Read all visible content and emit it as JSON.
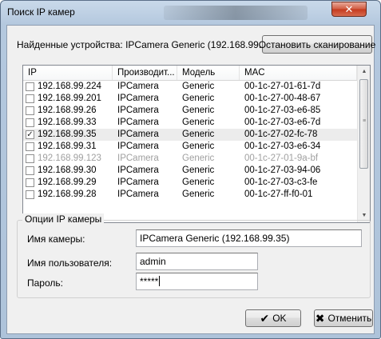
{
  "window": {
    "title": "Поиск IP камер",
    "close_glyph": "✕"
  },
  "found": {
    "label": "Найденные устройства: IPCamera Generic (192.168.99.38)",
    "stop_button": "Остановить сканирование"
  },
  "table": {
    "columns": [
      "IP",
      "Производит...",
      "Модель",
      "MAC"
    ],
    "rows": [
      {
        "checked": false,
        "disabled": false,
        "ip": "192.168.99.224",
        "maker": "IPCamera",
        "model": "Generic",
        "mac": "00-1c-27-01-61-7d"
      },
      {
        "checked": false,
        "disabled": false,
        "ip": "192.168.99.201",
        "maker": "IPCamera",
        "model": "Generic",
        "mac": "00-1c-27-00-48-67"
      },
      {
        "checked": false,
        "disabled": false,
        "ip": "192.168.99.26",
        "maker": "IPCamera",
        "model": "Generic",
        "mac": "00-1c-27-03-e6-85"
      },
      {
        "checked": false,
        "disabled": false,
        "ip": "192.168.99.33",
        "maker": "IPCamera",
        "model": "Generic",
        "mac": "00-1c-27-03-e6-7d"
      },
      {
        "checked": true,
        "disabled": false,
        "selected": true,
        "ip": "192.168.99.35",
        "maker": "IPCamera",
        "model": "Generic",
        "mac": "00-1c-27-02-fc-78"
      },
      {
        "checked": false,
        "disabled": false,
        "ip": "192.168.99.31",
        "maker": "IPCamera",
        "model": "Generic",
        "mac": "00-1c-27-03-e6-34"
      },
      {
        "checked": false,
        "disabled": true,
        "ip": "192.168.99.123",
        "maker": "IPCamera",
        "model": "Generic",
        "mac": "00-1c-27-01-9a-bf"
      },
      {
        "checked": false,
        "disabled": false,
        "ip": "192.168.99.30",
        "maker": "IPCamera",
        "model": "Generic",
        "mac": "00-1c-27-03-94-06"
      },
      {
        "checked": false,
        "disabled": false,
        "ip": "192.168.99.29",
        "maker": "IPCamera",
        "model": "Generic",
        "mac": "00-1c-27-03-c3-fe"
      },
      {
        "checked": false,
        "disabled": false,
        "ip": "192.168.99.28",
        "maker": "IPCamera",
        "model": "Generic",
        "mac": "00-1c-27-ff-f0-01"
      }
    ]
  },
  "options": {
    "group_title": "Опции IP камеры",
    "camera_name_label": "Имя камеры:",
    "camera_name_value": "IPCamera Generic (192.168.99.35)",
    "username_label": "Имя пользователя:",
    "username_value": "admin",
    "password_label": "Пароль:",
    "password_value": "*****"
  },
  "buttons": {
    "ok": "OK",
    "ok_glyph": "✔",
    "cancel": "Отменить",
    "cancel_glyph": "✖"
  },
  "icons": {
    "checkbox_check": "✓",
    "scroll_up": "▲",
    "scroll_down": "▼",
    "scroll_grip": "≡"
  }
}
